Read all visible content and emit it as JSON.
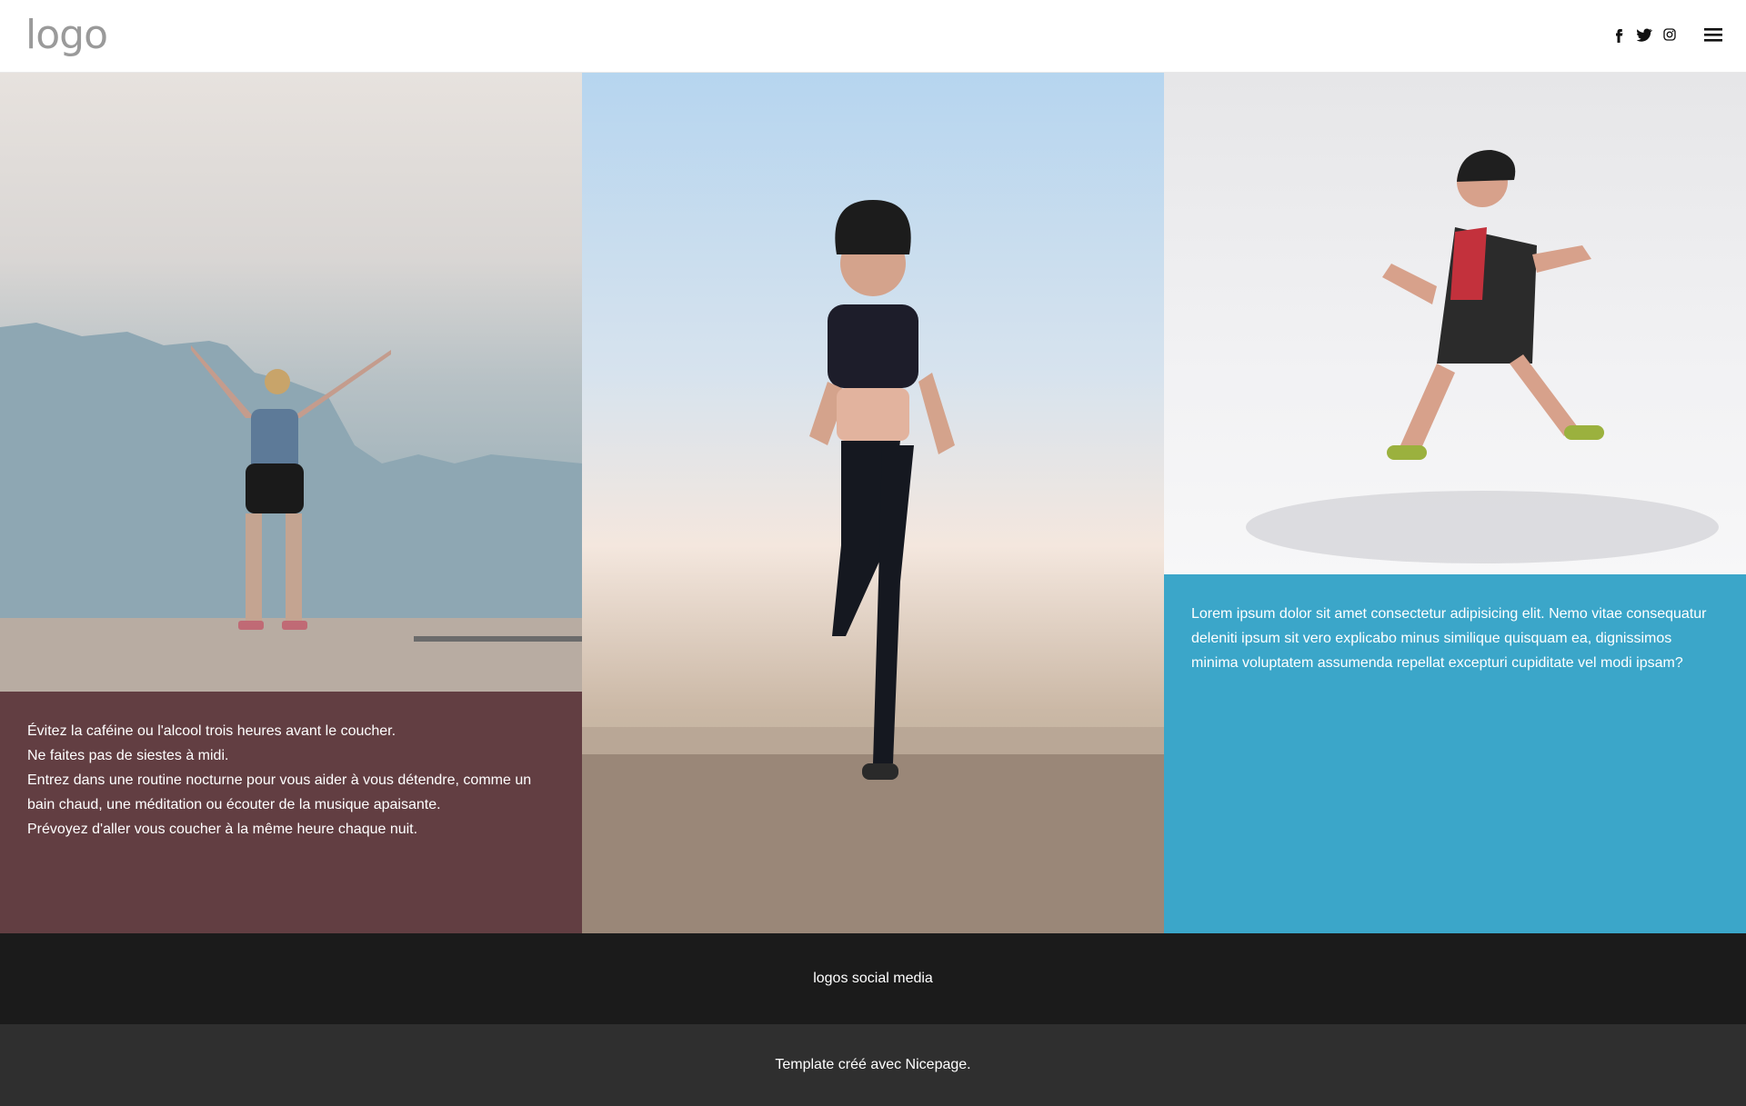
{
  "header": {
    "logo_text": "logo",
    "social_icons": [
      "facebook-icon",
      "twitter-icon",
      "instagram-icon"
    ],
    "menu_icon": "hamburger-menu-icon"
  },
  "content": {
    "left_panel": {
      "background": "#623e42",
      "lines": [
        "Évitez la caféine ou l'alcool trois heures avant le coucher.",
        "Ne faites pas de siestes à midi.",
        "Entrez dans une routine nocturne pour vous aider à vous détendre, comme un bain chaud, une méditation ou écouter de la musique apaisante.",
        "Prévoyez d'aller vous coucher à la même heure chaque nuit."
      ]
    },
    "right_panel": {
      "background": "#3ba6c9",
      "text": "Lorem ipsum dolor sit amet consectetur adipisicing elit. Nemo vitae consequatur deleniti ipsum sit vero explicabo minus similique quisquam ea, dignissimos minima voluptatem assumenda repellat excepturi cupiditate vel modi ipsam?"
    }
  },
  "footer": {
    "social_label": "logos social media",
    "credit": "Template créé avec Nicepage."
  }
}
